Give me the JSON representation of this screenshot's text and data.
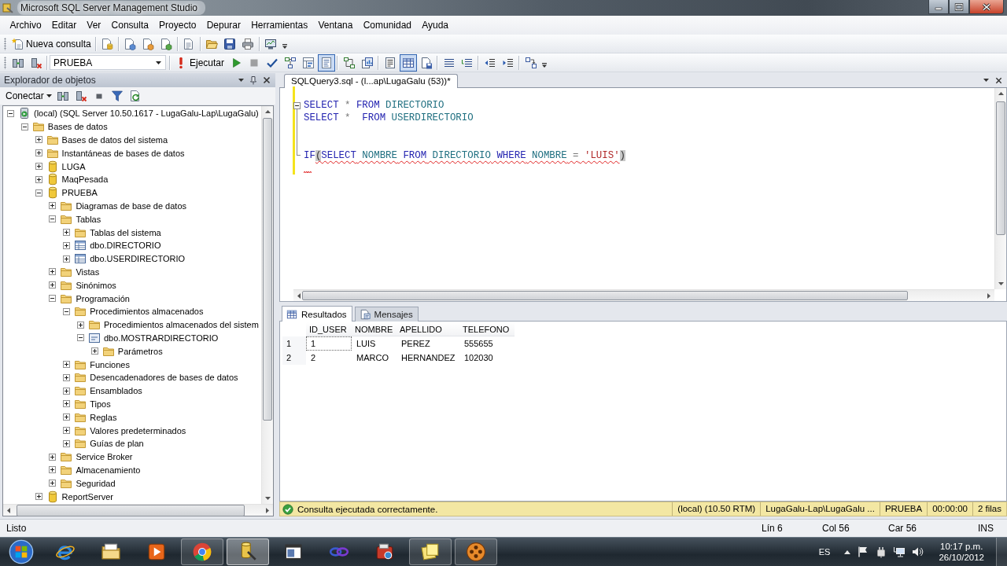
{
  "window": {
    "title": "Microsoft SQL Server Management Studio"
  },
  "menu": [
    "Archivo",
    "Editar",
    "Ver",
    "Consulta",
    "Proyecto",
    "Depurar",
    "Herramientas",
    "Ventana",
    "Comunidad",
    "Ayuda"
  ],
  "standard_toolbar": {
    "new_query": "Nueva consulta"
  },
  "sql_toolbar": {
    "database": "PRUEBA",
    "execute": "Ejecutar",
    "buttons": [
      {
        "pressed": false,
        "disabled": false
      },
      {
        "pressed": false,
        "disabled": true
      },
      {
        "pressed": false,
        "disabled": false
      },
      {
        "pressed": false,
        "disabled": false
      },
      {
        "pressed": false,
        "disabled": false
      },
      {
        "pressed": true,
        "disabled": false
      },
      {
        "pressed": false,
        "disabled": false
      },
      {
        "pressed": false,
        "disabled": false
      },
      {
        "pressed": false,
        "disabled": false
      },
      {
        "pressed": true,
        "disabled": false
      },
      {
        "pressed": false,
        "disabled": false
      },
      {
        "pressed": false,
        "disabled": false
      },
      {
        "pressed": false,
        "disabled": false
      },
      {
        "pressed": false,
        "disabled": false
      },
      {
        "pressed": false,
        "disabled": false
      },
      {
        "pressed": false,
        "disabled": false
      }
    ]
  },
  "object_explorer": {
    "title": "Explorador de objetos",
    "connect": "Conectar",
    "tree": [
      {
        "label": "(local) (SQL Server 10.50.1617 - LugaGalu-Lap\\LugaGalu)",
        "kind": "server",
        "expanded": true,
        "children": [
          {
            "label": "Bases de datos",
            "kind": "folder",
            "expanded": true,
            "children": [
              {
                "label": "Bases de datos del sistema",
                "kind": "folder",
                "expanded": false
              },
              {
                "label": "Instantáneas de bases de datos",
                "kind": "folder",
                "expanded": false
              },
              {
                "label": "LUGA",
                "kind": "database",
                "expanded": false
              },
              {
                "label": "MaqPesada",
                "kind": "database",
                "expanded": false
              },
              {
                "label": "PRUEBA",
                "kind": "database",
                "expanded": true,
                "children": [
                  {
                    "label": "Diagramas de base de datos",
                    "kind": "folder",
                    "expanded": false
                  },
                  {
                    "label": "Tablas",
                    "kind": "folder",
                    "expanded": true,
                    "children": [
                      {
                        "label": "Tablas del sistema",
                        "kind": "folder",
                        "expanded": false
                      },
                      {
                        "label": "dbo.DIRECTORIO",
                        "kind": "table",
                        "expanded": false
                      },
                      {
                        "label": "dbo.USERDIRECTORIO",
                        "kind": "table",
                        "expanded": false
                      }
                    ]
                  },
                  {
                    "label": "Vistas",
                    "kind": "folder",
                    "expanded": false
                  },
                  {
                    "label": "Sinónimos",
                    "kind": "folder",
                    "expanded": false
                  },
                  {
                    "label": "Programación",
                    "kind": "folder",
                    "expanded": true,
                    "children": [
                      {
                        "label": "Procedimientos almacenados",
                        "kind": "folder",
                        "expanded": true,
                        "children": [
                          {
                            "label": "Procedimientos almacenados del sistem",
                            "kind": "folder",
                            "expanded": false
                          },
                          {
                            "label": "dbo.MOSTRARDIRECTORIO",
                            "kind": "procedure",
                            "expanded": true,
                            "children": [
                              {
                                "label": "Parámetros",
                                "kind": "folder",
                                "expanded": false
                              }
                            ]
                          }
                        ]
                      },
                      {
                        "label": "Funciones",
                        "kind": "folder",
                        "expanded": false
                      },
                      {
                        "label": "Desencadenadores de bases de datos",
                        "kind": "folder",
                        "expanded": false
                      },
                      {
                        "label": "Ensamblados",
                        "kind": "folder",
                        "expanded": false
                      },
                      {
                        "label": "Tipos",
                        "kind": "folder",
                        "expanded": false
                      },
                      {
                        "label": "Reglas",
                        "kind": "folder",
                        "expanded": false
                      },
                      {
                        "label": "Valores predeterminados",
                        "kind": "folder",
                        "expanded": false
                      },
                      {
                        "label": "Guías de plan",
                        "kind": "folder",
                        "expanded": false
                      }
                    ]
                  },
                  {
                    "label": "Service Broker",
                    "kind": "folder",
                    "expanded": false
                  },
                  {
                    "label": "Almacenamiento",
                    "kind": "folder",
                    "expanded": false
                  },
                  {
                    "label": "Seguridad",
                    "kind": "folder",
                    "expanded": false
                  }
                ]
              },
              {
                "label": "ReportServer",
                "kind": "database",
                "expanded": false
              }
            ]
          }
        ]
      }
    ]
  },
  "editor": {
    "tabs": [
      {
        "label": "SQLQuery3.sql - (l...ap\\LugaGalu (53))*",
        "selected": true
      }
    ],
    "lines": [
      {
        "kind": "plain",
        "changed": true
      },
      {
        "kind": "start",
        "expanded": true,
        "changed": true,
        "tokens": [
          {
            "kind": "keyword",
            "text": "SELECT",
            "error": false
          },
          {
            "kind": "operator",
            "text": " *",
            "error": false
          },
          {
            "kind": "keyword",
            "text": " FROM",
            "error": false
          },
          {
            "kind": "identifier",
            "text": " DIRECTORIO",
            "error": false
          }
        ]
      },
      {
        "kind": "inside",
        "changed": true,
        "tokens": [
          {
            "kind": "keyword",
            "text": "SELECT",
            "error": false
          },
          {
            "kind": "operator",
            "text": " *",
            "error": false
          },
          {
            "kind": "keyword",
            "text": "  FROM",
            "error": false
          },
          {
            "kind": "identifier",
            "text": " USERDIRECTORIO",
            "error": false
          }
        ]
      },
      {
        "kind": "inside",
        "changed": true
      },
      {
        "kind": "inside",
        "changed": true
      },
      {
        "kind": "end",
        "changed": true,
        "tokens": [
          {
            "kind": "keyword",
            "text": "IF",
            "error": false
          },
          {
            "kind": "brace",
            "text": "(",
            "error": true
          },
          {
            "kind": "keyword",
            "text": "SELECT",
            "error": true
          },
          {
            "kind": "identifier",
            "text": " NOMBRE",
            "error": true
          },
          {
            "kind": "keyword",
            "text": " FROM",
            "error": true
          },
          {
            "kind": "identifier",
            "text": " DIRECTORIO",
            "error": true
          },
          {
            "kind": "keyword",
            "text": " WHERE",
            "error": true
          },
          {
            "kind": "identifier",
            "text": " NOMBRE",
            "error": true
          },
          {
            "kind": "operator",
            "text": " =",
            "error": true
          },
          {
            "kind": "string",
            "text": " 'LUIS'",
            "error": true
          },
          {
            "kind": "brace",
            "text": ")",
            "error": false
          }
        ]
      },
      {
        "kind": "plain",
        "changed": true,
        "squiggle": true
      }
    ]
  },
  "results": {
    "tabs": [
      {
        "label": "Resultados",
        "selected": true
      },
      {
        "label": "Mensajes",
        "selected": false
      }
    ],
    "columns": [
      "ID_USER",
      "NOMBRE",
      "APELLIDO",
      "TELEFONO"
    ],
    "rows": [
      {
        "number": "1",
        "cells": [
          {
            "text": "1",
            "selected": true
          },
          {
            "text": "LUIS",
            "selected": false
          },
          {
            "text": "PEREZ",
            "selected": false
          },
          {
            "text": "555655",
            "selected": false
          }
        ]
      },
      {
        "number": "2",
        "cells": [
          {
            "text": "2",
            "selected": false
          },
          {
            "text": "MARCO",
            "selected": false
          },
          {
            "text": "HERNANDEZ",
            "selected": false
          },
          {
            "text": "102030",
            "selected": false
          }
        ]
      }
    ]
  },
  "query_status": {
    "message": "Consulta ejecutada correctamente.",
    "server": "(local) (10.50 RTM)",
    "login": "LugaGalu-Lap\\LugaGalu ...",
    "database": "PRUEBA",
    "elapsed": "00:00:00",
    "rows": "2 filas"
  },
  "status_bar": {
    "message": "Listo",
    "line": "Lín 6",
    "column": "Col 56",
    "character": "Car 56",
    "mode": "INS"
  },
  "taskbar": {
    "apps": [
      {
        "open": false,
        "active": false
      },
      {
        "open": false,
        "active": false
      },
      {
        "open": false,
        "active": false
      },
      {
        "open": true,
        "active": false
      },
      {
        "open": true,
        "active": true
      },
      {
        "open": false,
        "active": false
      },
      {
        "open": false,
        "active": false
      },
      {
        "open": false,
        "active": false
      },
      {
        "open": true,
        "active": false
      },
      {
        "open": true,
        "active": false
      }
    ],
    "language": "ES",
    "time": "10:17 p.m.",
    "date": "26/10/2012"
  }
}
